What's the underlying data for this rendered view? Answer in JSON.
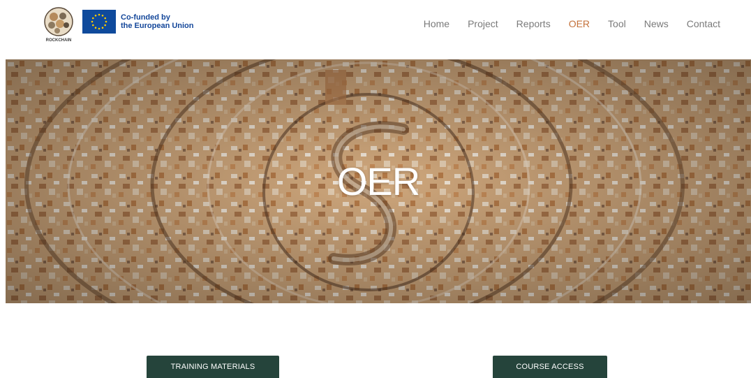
{
  "header": {
    "logo_alt": "ROCKCHAIN",
    "eu_line1": "Co-funded by",
    "eu_line2": "the European Union"
  },
  "nav": {
    "items": [
      {
        "label": "Home"
      },
      {
        "label": "Project"
      },
      {
        "label": "Reports"
      },
      {
        "label": "OER",
        "active": true
      },
      {
        "label": "Tool"
      },
      {
        "label": "News"
      },
      {
        "label": "Contact"
      }
    ]
  },
  "hero": {
    "title": "OER"
  },
  "actions": {
    "training_label": "TRAINING MATERIALS",
    "course_label": "COURSE ACCESS"
  },
  "colors": {
    "accent": "#c4713a",
    "button": "#25443b",
    "eu_blue": "#0f4a9c"
  }
}
